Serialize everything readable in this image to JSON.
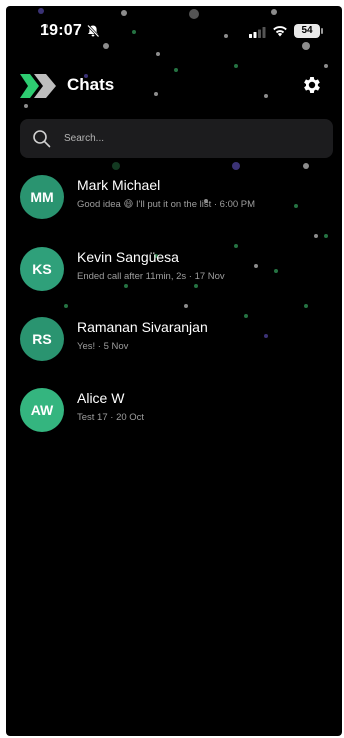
{
  "status_bar": {
    "time": "19:07",
    "battery": "54"
  },
  "header": {
    "title": "Chats"
  },
  "search": {
    "placeholder": "Search..."
  },
  "chats": [
    {
      "initials": "MM",
      "name": "Mark Michael",
      "preview": "Good idea 😄 I'll put it on the list · 6:00 PM",
      "avatar_color": "#2a9470"
    },
    {
      "initials": "KS",
      "name": "Kevin Sangüesa",
      "preview": "Ended call after 11min, 2s · 17 Nov",
      "avatar_color": "#2fa07a"
    },
    {
      "initials": "RS",
      "name": "Ramanan Sivaranjan",
      "preview": "Yes! · 5 Nov",
      "avatar_color": "#2a9470"
    },
    {
      "initials": "AW",
      "name": "Alice W",
      "preview": "Test 17 · 20 Oct",
      "avatar_color": "#34b57f"
    }
  ],
  "colors": {
    "accent": "#2ecc71",
    "background": "#000000",
    "search_bg": "#1c1c1e"
  }
}
